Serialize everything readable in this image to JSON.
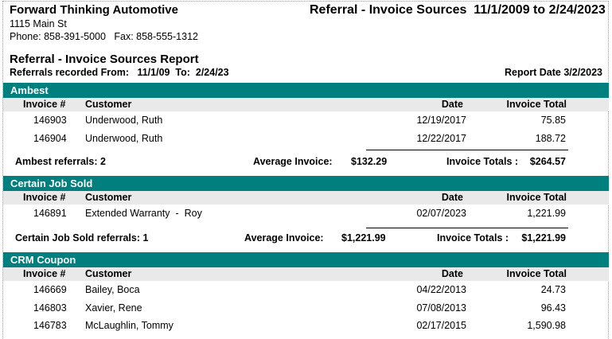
{
  "header": {
    "company": "Forward Thinking Automotive",
    "address": "1115 Main St",
    "phone_line": "Phone: 858-391-5000   Fax: 858-555-1312",
    "report_title": "Referral - Invoice Sources  11/1/2009 to 2/24/2023",
    "report_name": "Referral - Invoice Sources Report",
    "recorded_line": "Referrals recorded From:   11/1/09  To:  2/24/23",
    "report_date": "Report Date 3/2/2023"
  },
  "columns": {
    "invoice": "Invoice #",
    "customer": "Customer",
    "date": "Date",
    "total": "Invoice Total"
  },
  "sections": [
    {
      "name": "Ambest",
      "rows": [
        {
          "invoice": "146903",
          "customer": "Underwood, Ruth",
          "date": "12/19/2017",
          "total": "75.85"
        },
        {
          "invoice": "146904",
          "customer": "Underwood, Ruth",
          "date": "12/22/2017",
          "total": "188.72"
        }
      ],
      "referrals": "Ambest referrals: 2",
      "avg_label": "Average Invoice:",
      "avg_value": "$132.29",
      "totals_label": "Invoice Totals :",
      "totals_value": "$264.57"
    },
    {
      "name": "Certain Job Sold",
      "rows": [
        {
          "invoice": "146891",
          "customer": "Extended Warranty  -  Roy",
          "date": "02/07/2023",
          "total": "1,221.99"
        }
      ],
      "referrals": "Certain Job Sold referrals: 1",
      "avg_label": "Average Invoice:",
      "avg_value": "$1,221.99",
      "totals_label": "Invoice Totals :",
      "totals_value": "$1,221.99"
    },
    {
      "name": "CRM Coupon",
      "rows": [
        {
          "invoice": "146669",
          "customer": "Bailey, Boca",
          "date": "04/22/2013",
          "total": "24.73"
        },
        {
          "invoice": "146803",
          "customer": "Xavier, Rene",
          "date": "07/08/2013",
          "total": "96.43"
        },
        {
          "invoice": "146783",
          "customer": "McLaughlin, Tommy",
          "date": "02/17/2015",
          "total": "1,590.98"
        }
      ]
    }
  ]
}
